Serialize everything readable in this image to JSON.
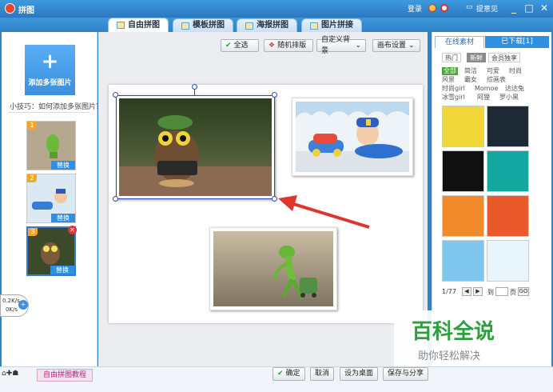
{
  "window": {
    "title": "拼图",
    "login": "登录",
    "feedback": "提意见"
  },
  "tabs": [
    {
      "label": "自由拼图",
      "active": true
    },
    {
      "label": "模板拼图",
      "active": false
    },
    {
      "label": "海报拼图",
      "active": false
    },
    {
      "label": "图片拼接",
      "active": false
    }
  ],
  "left": {
    "add_label": "添加多张图片",
    "tip": "小技巧：如何添加多张图片？",
    "thumbs": [
      {
        "num": "1",
        "replace": "替换"
      },
      {
        "num": "2",
        "replace": "替换"
      },
      {
        "num": "3",
        "replace": "替换"
      }
    ]
  },
  "toolbar": {
    "select_all": "全选",
    "random": "随机排版",
    "custom_bg": "自定义背景",
    "canvas_settings": "画布设置"
  },
  "right": {
    "tab_online": "在线素材",
    "tab_downloaded": "已下载[1]",
    "chips": [
      "热门",
      "新鲜",
      "会员独享"
    ],
    "categories": [
      "全部",
      "简洁",
      "可爱",
      "时尚",
      "风景",
      "霸女",
      "综画表",
      "时尚girl",
      "Momoe",
      "达达兔",
      "冰雪girl",
      "阿狸",
      "罗小黑"
    ],
    "pager": {
      "current": "1/77",
      "goto": "到",
      "page": "页",
      "go": "GO"
    }
  },
  "bottom": {
    "confirm": "确定",
    "cancel": "取消",
    "set_desktop": "设为桌面",
    "save_share": "保存与分享",
    "tutorial": "自由拼图教程"
  },
  "speed": {
    "up": "0.2K/s",
    "down": "0K/s"
  },
  "watermark": {
    "title": "百科全说",
    "subtitle": "助你轻松解决"
  },
  "colors": {
    "accent": "#2f84c9",
    "selection": "#2a48b8",
    "arrow": "#e0342f"
  }
}
